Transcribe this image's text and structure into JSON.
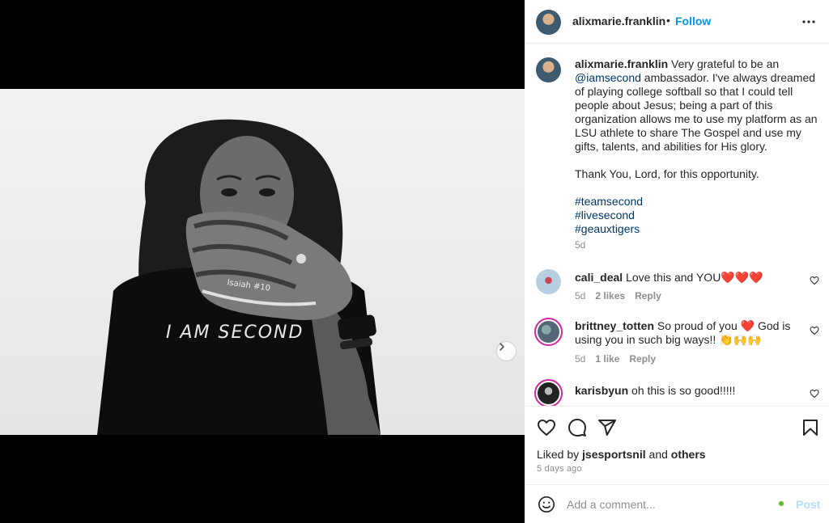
{
  "post": {
    "username": "alixmarie.franklin",
    "separator": "•",
    "follow_label": "Follow",
    "more_icon": "more-horizontal-icon",
    "image_alt": "Softball player holding a glove over her face",
    "carousel": {
      "total": 2,
      "current": 1
    },
    "next_icon": "chevron-right-icon"
  },
  "caption": {
    "username": "alixmarie.franklin",
    "text_before_mention": " Very grateful to be an ",
    "mention": "@iamsecond",
    "text_after_mention": " ambassador. I've always dreamed of playing college softball so that I could tell people about Jesus; being a part of this organization allows me to use my platform as an LSU athlete to share The Gospel and use my gifts, talents, and abilities for His glory.",
    "paragraph2": "Thank You, Lord, for this opportunity.",
    "hashtags": [
      "#teamsecond",
      "#livesecond",
      "#geauxtigers"
    ],
    "time": "5d"
  },
  "comments": [
    {
      "username": "cali_deal",
      "text": " Love this and YOU❤️❤️❤️",
      "time": "5d",
      "likes": "2 likes",
      "reply": "Reply"
    },
    {
      "username": "brittney_totten",
      "text": " So proud of you ❤️ God is using you in such big ways!! 👏🙌🙌",
      "time": "5d",
      "likes": "1 like",
      "reply": "Reply"
    },
    {
      "username": "karisbyun",
      "text": " oh this is so good!!!!!"
    }
  ],
  "actions": {
    "liked_prefix": "Liked by ",
    "liked_user": "jsesportsnil",
    "liked_and": " and ",
    "liked_others": "others",
    "date": "5 days ago"
  },
  "add_comment": {
    "placeholder": "Add a comment...",
    "post_label": "Post"
  },
  "colors": {
    "follow": "#0095f6",
    "link": "#00376b",
    "story_ring": "#d6249f",
    "post_disabled": "#b2dffc",
    "status_dot": "#58c322"
  }
}
